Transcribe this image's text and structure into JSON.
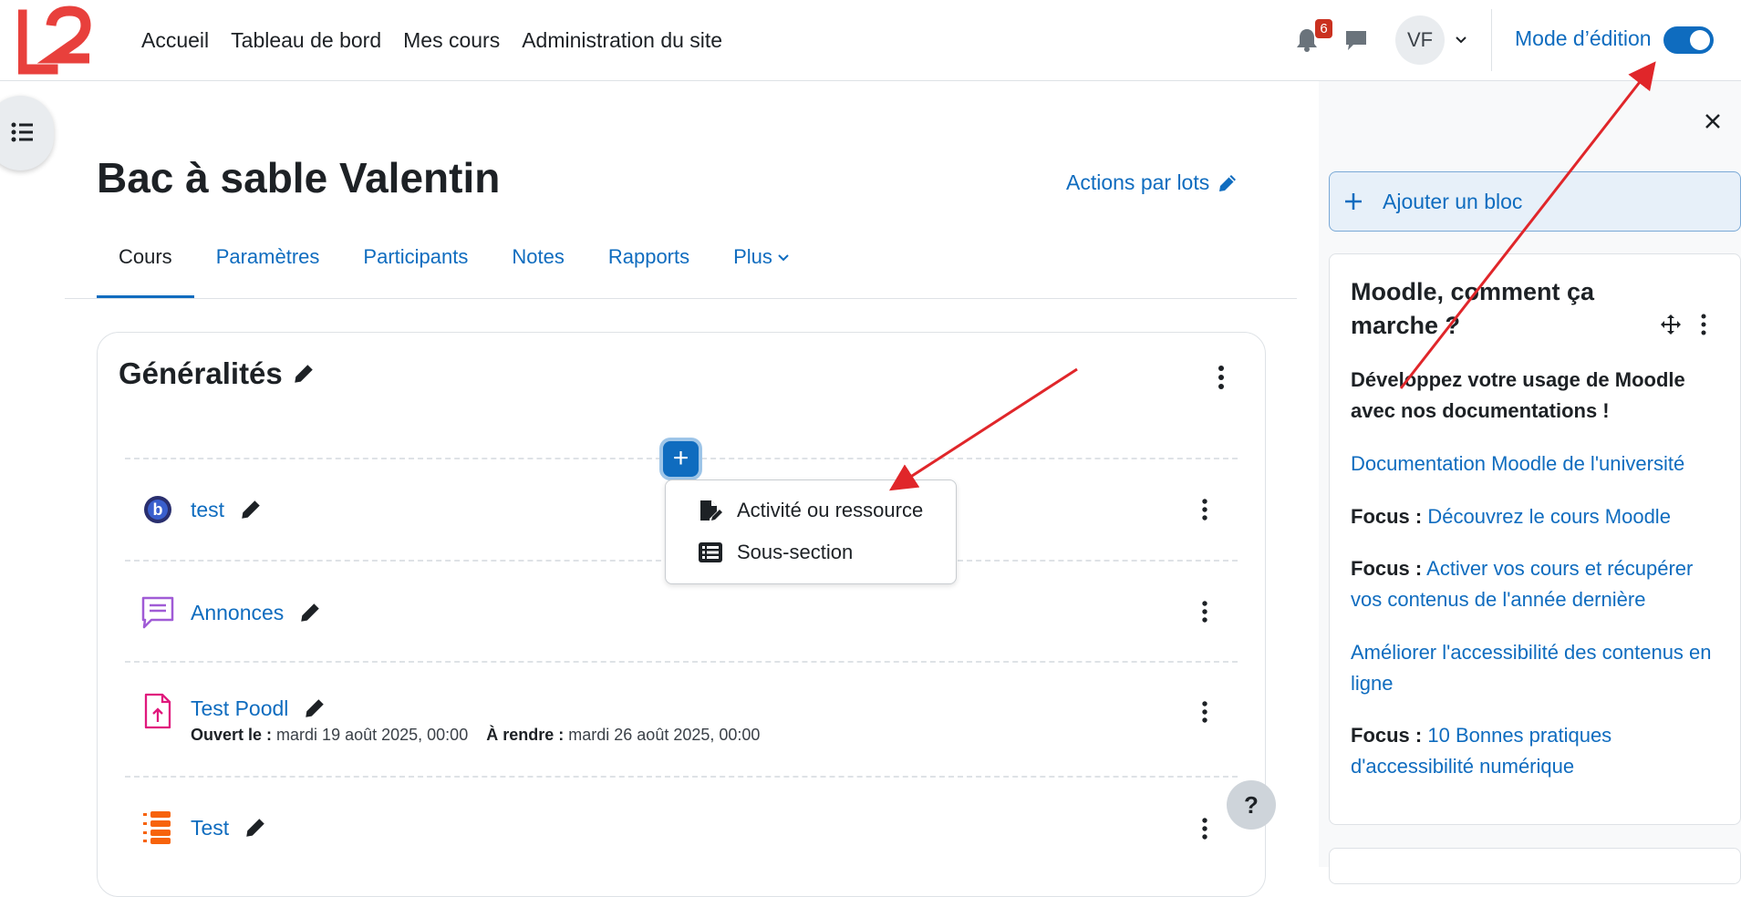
{
  "brand": {
    "logo_text": "L2"
  },
  "nav": {
    "items": [
      {
        "label": "Accueil"
      },
      {
        "label": "Tableau de bord"
      },
      {
        "label": "Mes cours"
      },
      {
        "label": "Administration du site"
      }
    ]
  },
  "header": {
    "notification_count": "6",
    "user_initials": "VF",
    "edit_mode_label": "Mode d’édition",
    "edit_mode_on": true
  },
  "course": {
    "title": "Bac à sable Valentin",
    "bulk_actions": "Actions par lots"
  },
  "tabs": [
    {
      "label": "Cours"
    },
    {
      "label": "Paramètres"
    },
    {
      "label": "Participants"
    },
    {
      "label": "Notes"
    },
    {
      "label": "Rapports"
    },
    {
      "label": "Plus"
    }
  ],
  "section": {
    "title": "Généralités"
  },
  "add_menu": {
    "button": "+",
    "items": [
      {
        "label": "Activité ou ressource",
        "icon": "file-edit-icon"
      },
      {
        "label": "Sous-section",
        "icon": "list-icon"
      }
    ]
  },
  "activities": [
    {
      "name": "test",
      "icon": "bigbluebutton-icon"
    },
    {
      "name": "Annonces",
      "icon": "forum-icon"
    },
    {
      "name": "Test Poodl",
      "icon": "assignment-icon",
      "open_label": "Ouvert le :",
      "open_value": "mardi 19 août 2025, 00:00",
      "due_label": "À rendre :",
      "due_value": "mardi 26 août 2025, 00:00"
    },
    {
      "name": "Test",
      "icon": "quiz-icon"
    }
  ],
  "help": {
    "label": "?"
  },
  "drawer": {
    "add_block": "Ajouter un bloc",
    "block": {
      "title": "Moodle, comment ça marche ?",
      "subtitle": "Développez votre usage de Moodle avec nos documentations !",
      "links": [
        {
          "prefix": "",
          "text": "Documentation Moodle de l'université"
        },
        {
          "prefix": "Focus :",
          "text": "Découvrez le cours Moodle"
        },
        {
          "prefix": "Focus :",
          "text": "Activer vos cours et récupérer vos contenus de l'année dernière"
        },
        {
          "prefix": "",
          "text": "Améliorer l'accessibilité des contenus en ligne"
        },
        {
          "prefix": "Focus :",
          "text": "10 Bonnes pratiques d'accessibilité numérique"
        }
      ]
    }
  },
  "colors": {
    "primary": "#0f6cbf",
    "logo": "#e8403c",
    "annotation": "#e0262a",
    "badge": "#ca3120"
  }
}
